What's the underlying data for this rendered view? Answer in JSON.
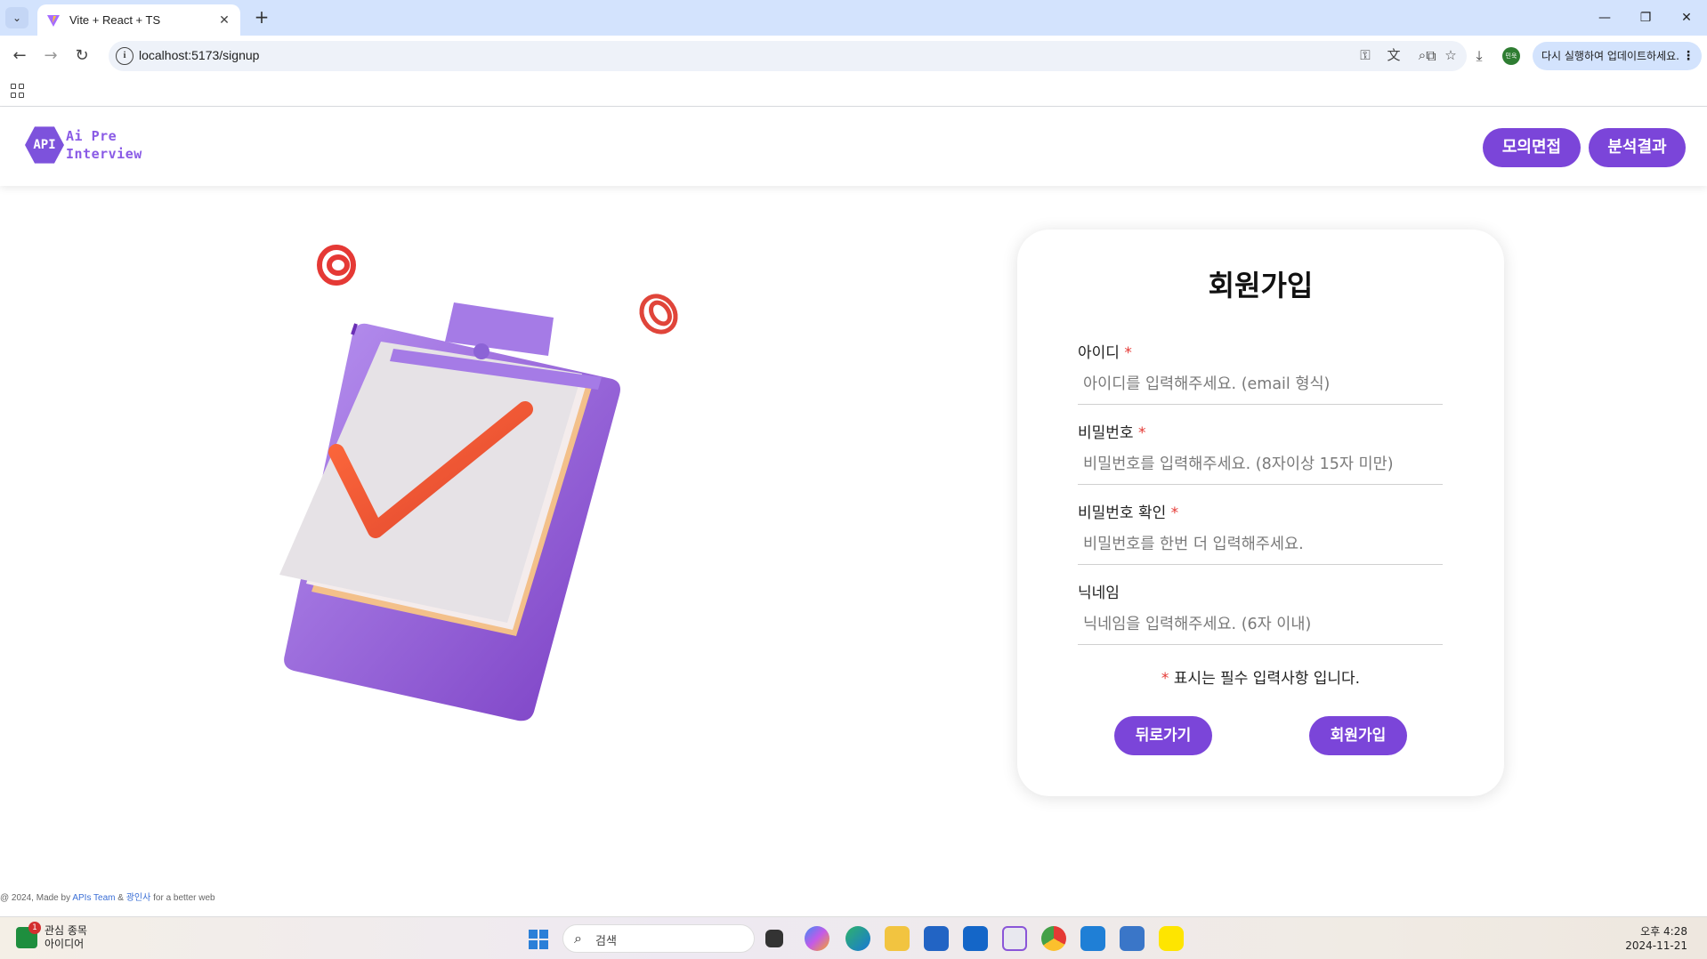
{
  "browser": {
    "tab_title": "Vite + React + TS",
    "url": "localhost:5173/signup",
    "update_label": "다시 실행하여 업데이트하세요.",
    "profile_label": "민욱"
  },
  "header": {
    "logo_badge": "API",
    "logo_line1": "Ai Pre",
    "logo_line2": "Interview",
    "nav": [
      "모의면접",
      "분석결과"
    ]
  },
  "signup": {
    "title": "회원가입",
    "fields": [
      {
        "label": "아이디",
        "required": "*",
        "placeholder": "아이디를 입력해주세요. (email 형식)"
      },
      {
        "label": "비밀번호",
        "required": "*",
        "placeholder": "비밀번호를 입력해주세요. (8자이상 15자 미만)"
      },
      {
        "label": "비밀번호 확인",
        "required": "*",
        "placeholder": "비밀번호를 한번 더 입력해주세요."
      },
      {
        "label": "닉네임",
        "required": "",
        "placeholder": "닉네임을 입력해주세요. (6자 이내)"
      }
    ],
    "notice_star": "*",
    "notice_text": " 표시는 필수 입력사항 입니다.",
    "back_button": "뒤로가기",
    "submit_button": "회원가입"
  },
  "footer": {
    "prefix": "@ 2024, Made by ",
    "team": "APIs Team",
    "amp": " & ",
    "author": "광인사",
    "suffix": " for a better web"
  },
  "taskbar": {
    "widget_title": "관심 종목",
    "widget_sub": "아이디어",
    "widget_badge": "1",
    "search_placeholder": "검색",
    "time": "오후 4:28",
    "date": "2024-11-21"
  },
  "colors": {
    "accent": "#7b45d9",
    "required": "#e53935",
    "tab_bar": "#d3e3fd"
  }
}
